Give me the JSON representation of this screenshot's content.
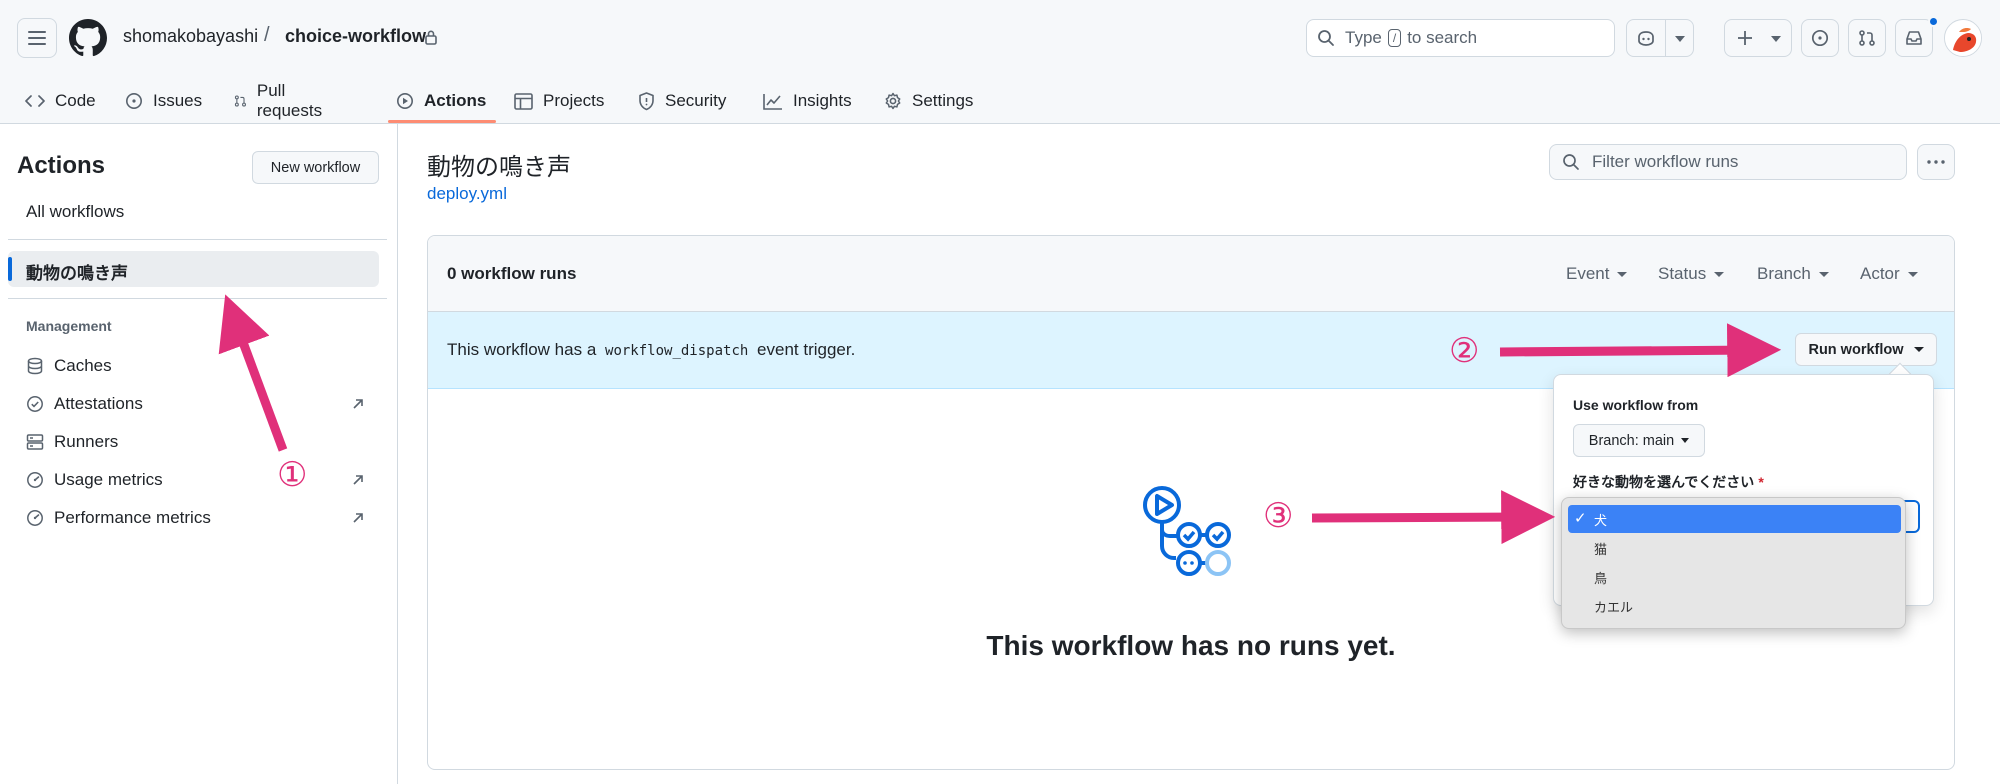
{
  "header": {
    "owner": "shomakobayashi",
    "separator": "/",
    "repo": "choice-workflow",
    "search_prefix": "Type",
    "search_key": "/",
    "search_suffix": "to search"
  },
  "nav": {
    "tabs": [
      {
        "label": "Code"
      },
      {
        "label": "Issues"
      },
      {
        "label": "Pull requests"
      },
      {
        "label": "Actions"
      },
      {
        "label": "Projects"
      },
      {
        "label": "Security"
      },
      {
        "label": "Insights"
      },
      {
        "label": "Settings"
      }
    ],
    "active_tab": "Actions"
  },
  "sidebar": {
    "title": "Actions",
    "new_workflow_label": "New workflow",
    "all_workflows": "All workflows",
    "selected_workflow": "動物の鳴き声",
    "section_label": "Management",
    "items": [
      {
        "label": "Caches",
        "icon": "database-icon",
        "external": false
      },
      {
        "label": "Attestations",
        "icon": "verified-icon",
        "external": true
      },
      {
        "label": "Runners",
        "icon": "server-icon",
        "external": false
      },
      {
        "label": "Usage metrics",
        "icon": "meter-icon",
        "external": true
      },
      {
        "label": "Performance metrics",
        "icon": "meter-icon",
        "external": true
      }
    ]
  },
  "main": {
    "workflow_title": "動物の鳴き声",
    "workflow_file": "deploy.yml",
    "filter_placeholder": "Filter workflow runs",
    "runs_count": "0 workflow runs",
    "filters": [
      "Event",
      "Status",
      "Branch",
      "Actor"
    ],
    "dispatch_prefix": "This workflow has a",
    "dispatch_code": "workflow_dispatch",
    "dispatch_suffix": "event trigger.",
    "run_workflow_label": "Run workflow",
    "empty_title": "This workflow has no runs yet."
  },
  "popover": {
    "use_from_label": "Use workflow from",
    "branch_label": "Branch: main",
    "input_label": "好きな動物を選んでください",
    "required_mark": "*",
    "options": [
      "犬",
      "猫",
      "鳥",
      "カエル"
    ],
    "selected_option": "犬"
  },
  "annotations": {
    "step1": "①",
    "step2": "②",
    "step3": "③",
    "color": "#e0307a"
  },
  "colors": {
    "accent": "#0969da",
    "tab_underline": "#fd8c73",
    "dispatch_bg": "#ddf4ff",
    "menu_highlight": "#3b82f6"
  }
}
